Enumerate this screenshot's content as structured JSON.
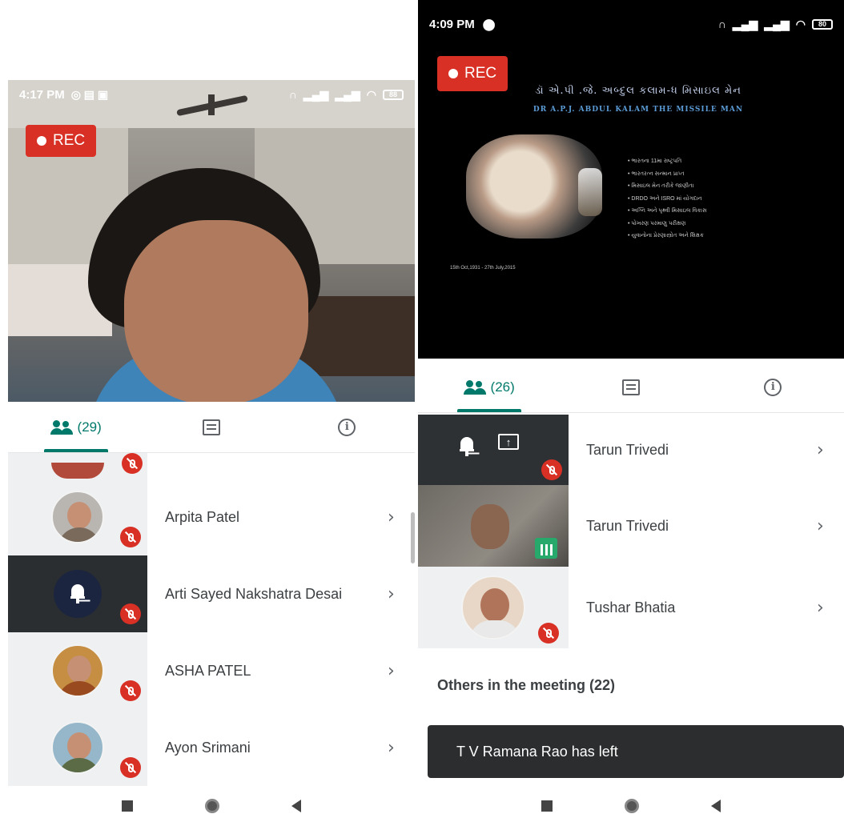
{
  "left": {
    "status_time": "4:17 PM",
    "battery": "88",
    "rec_label": "REC",
    "tabs": {
      "people_count": "(29)"
    },
    "participants": [
      {
        "name": "Arpita Patel",
        "avatar": "kid-avatar"
      },
      {
        "name": "Arti Sayed Nakshatra Desai",
        "avatar": "bell-avatar"
      },
      {
        "name": "ASHA PATEL",
        "avatar": "couple-avatar"
      },
      {
        "name": "Ayon Srimani",
        "avatar": "soldier-avatar"
      }
    ]
  },
  "right": {
    "status_time": "4:09 PM",
    "battery": "80",
    "rec_label": "REC",
    "slide": {
      "title": "ડૉ એ.પી .જે. અબ્દુલ કલામ-ધ મિસાઇલ મેન",
      "subtitle": "DR A.P.J. ABDUL KALAM THE MISSILE MAN",
      "dates": "15th Oct,1931 - 27th July,2015",
      "bullets": [
        "• ભારતના 11મા રાષ્ટ્રપતિ",
        "• ભારતરત્ન સન્માન પ્રાપ્ત",
        "• મિસાઇલ મેન તરીકે જાણીતા",
        "• DRDO અને ISRO માં યોગદાન",
        "• અગ્નિ અને પૃથ્વી મિસાઇલ વિકાસ",
        "• પોખરણ પરમાણુ પરીક્ષણ",
        "• યુવાનોના પ્રેરણાસ્ત્રોત અને શિક્ષક"
      ]
    },
    "tabs": {
      "people_count": "(26)"
    },
    "participants": [
      {
        "name": "Tarun Trivedi",
        "tile": "presenting"
      },
      {
        "name": "Tarun Trivedi",
        "tile": "camera"
      },
      {
        "name": "Tushar Bhatia",
        "tile": "avatar"
      }
    ],
    "others_heading": "Others in the meeting (22)",
    "toast": "T V Ramana Rao has left"
  },
  "icons": {
    "chevron": "›",
    "info": "i",
    "upload": "↑"
  },
  "colors": {
    "accent": "#00796b",
    "rec": "#d93025",
    "muted": "#d93025",
    "speaking": "#26a96a"
  }
}
